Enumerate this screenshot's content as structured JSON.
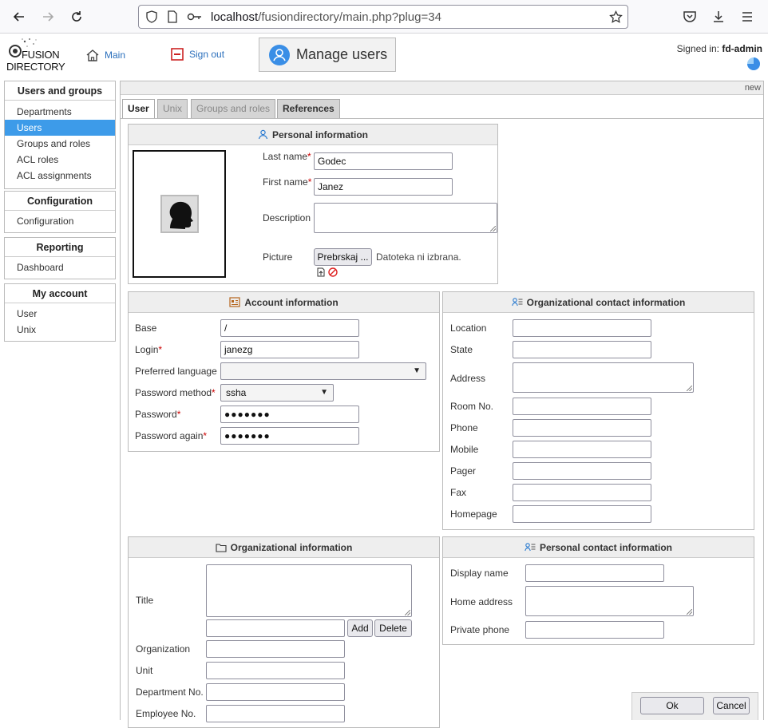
{
  "browser": {
    "url_host": "localhost",
    "url_path": "/fusiondirectory/main.php?plug=34"
  },
  "header": {
    "logo_top": "FUSION",
    "logo_bottom": "DIRECTORY",
    "main_link": "Main",
    "signout_link": "Sign out",
    "page_title": "Manage users",
    "signed_in_label": "Signed in:",
    "signed_in_user": "fd-admin"
  },
  "sidebar": [
    {
      "title": "Users and groups",
      "items": [
        "Departments",
        "Users",
        "Groups and roles",
        "ACL roles",
        "ACL assignments"
      ],
      "active": "Users"
    },
    {
      "title": "Configuration",
      "items": [
        "Configuration"
      ]
    },
    {
      "title": "Reporting",
      "items": [
        "Dashboard"
      ]
    },
    {
      "title": "My account",
      "items": [
        "User",
        "Unix"
      ]
    }
  ],
  "panel": {
    "status": "new",
    "tabs": [
      "User",
      "Unix",
      "Groups and roles",
      "References"
    ]
  },
  "personal": {
    "title": "Personal information",
    "last_name_label": "Last name",
    "last_name": "Godec",
    "first_name_label": "First name",
    "first_name": "Janez",
    "description_label": "Description",
    "picture_label": "Picture",
    "browse_button": "Prebrskaj ...",
    "no_file": "Datoteka ni izbrana."
  },
  "account": {
    "title": "Account information",
    "base_label": "Base",
    "base": "/",
    "login_label": "Login",
    "login": "janezg",
    "language_label": "Preferred language",
    "language": "",
    "method_label": "Password method",
    "method": "ssha",
    "password_label": "Password",
    "password": "●●●●●●●",
    "password_again_label": "Password again",
    "password_again": "●●●●●●●"
  },
  "org_contact": {
    "title": "Organizational contact information",
    "fields": [
      "Location",
      "State",
      "Address",
      "Room No.",
      "Phone",
      "Mobile",
      "Pager",
      "Fax",
      "Homepage"
    ]
  },
  "org_info": {
    "title": "Organizational information",
    "title_label": "Title",
    "add_button": "Add",
    "delete_button": "Delete",
    "fields": [
      "Organization",
      "Unit",
      "Department No.",
      "Employee No."
    ]
  },
  "personal_contact": {
    "title": "Personal contact information",
    "fields": [
      "Display name",
      "Home address",
      "Private phone"
    ]
  },
  "footer": {
    "ok_button": "Ok",
    "cancel_button": "Cancel"
  }
}
